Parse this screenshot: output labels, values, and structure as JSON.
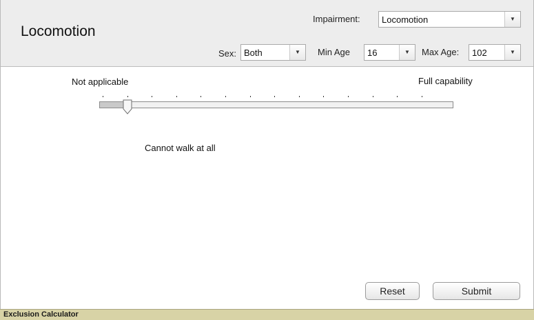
{
  "header": {
    "title": "Locomotion",
    "impairment_label": "Impairment:",
    "impairment_value": "Locomotion",
    "sex_label": "Sex:",
    "sex_value": "Both",
    "min_age_label": "Min Age",
    "min_age_value": "16",
    "max_age_label": "Max Age:",
    "max_age_value": "102"
  },
  "scale": {
    "left_label": "Not applicable",
    "right_label": "Full capability",
    "tick_count": 14,
    "selected_index": 1,
    "description": "Cannot walk at all"
  },
  "buttons": {
    "reset_label": "Reset",
    "submit_label": "Submit"
  },
  "status_bar": {
    "text": "Exclusion Calculator"
  },
  "icons": {
    "dropdown": "chevron-down-icon",
    "slider_thumb": "slider-thumb"
  },
  "colors": {
    "header_bg": "#ededed",
    "status_bg": "#d8d3a6"
  }
}
